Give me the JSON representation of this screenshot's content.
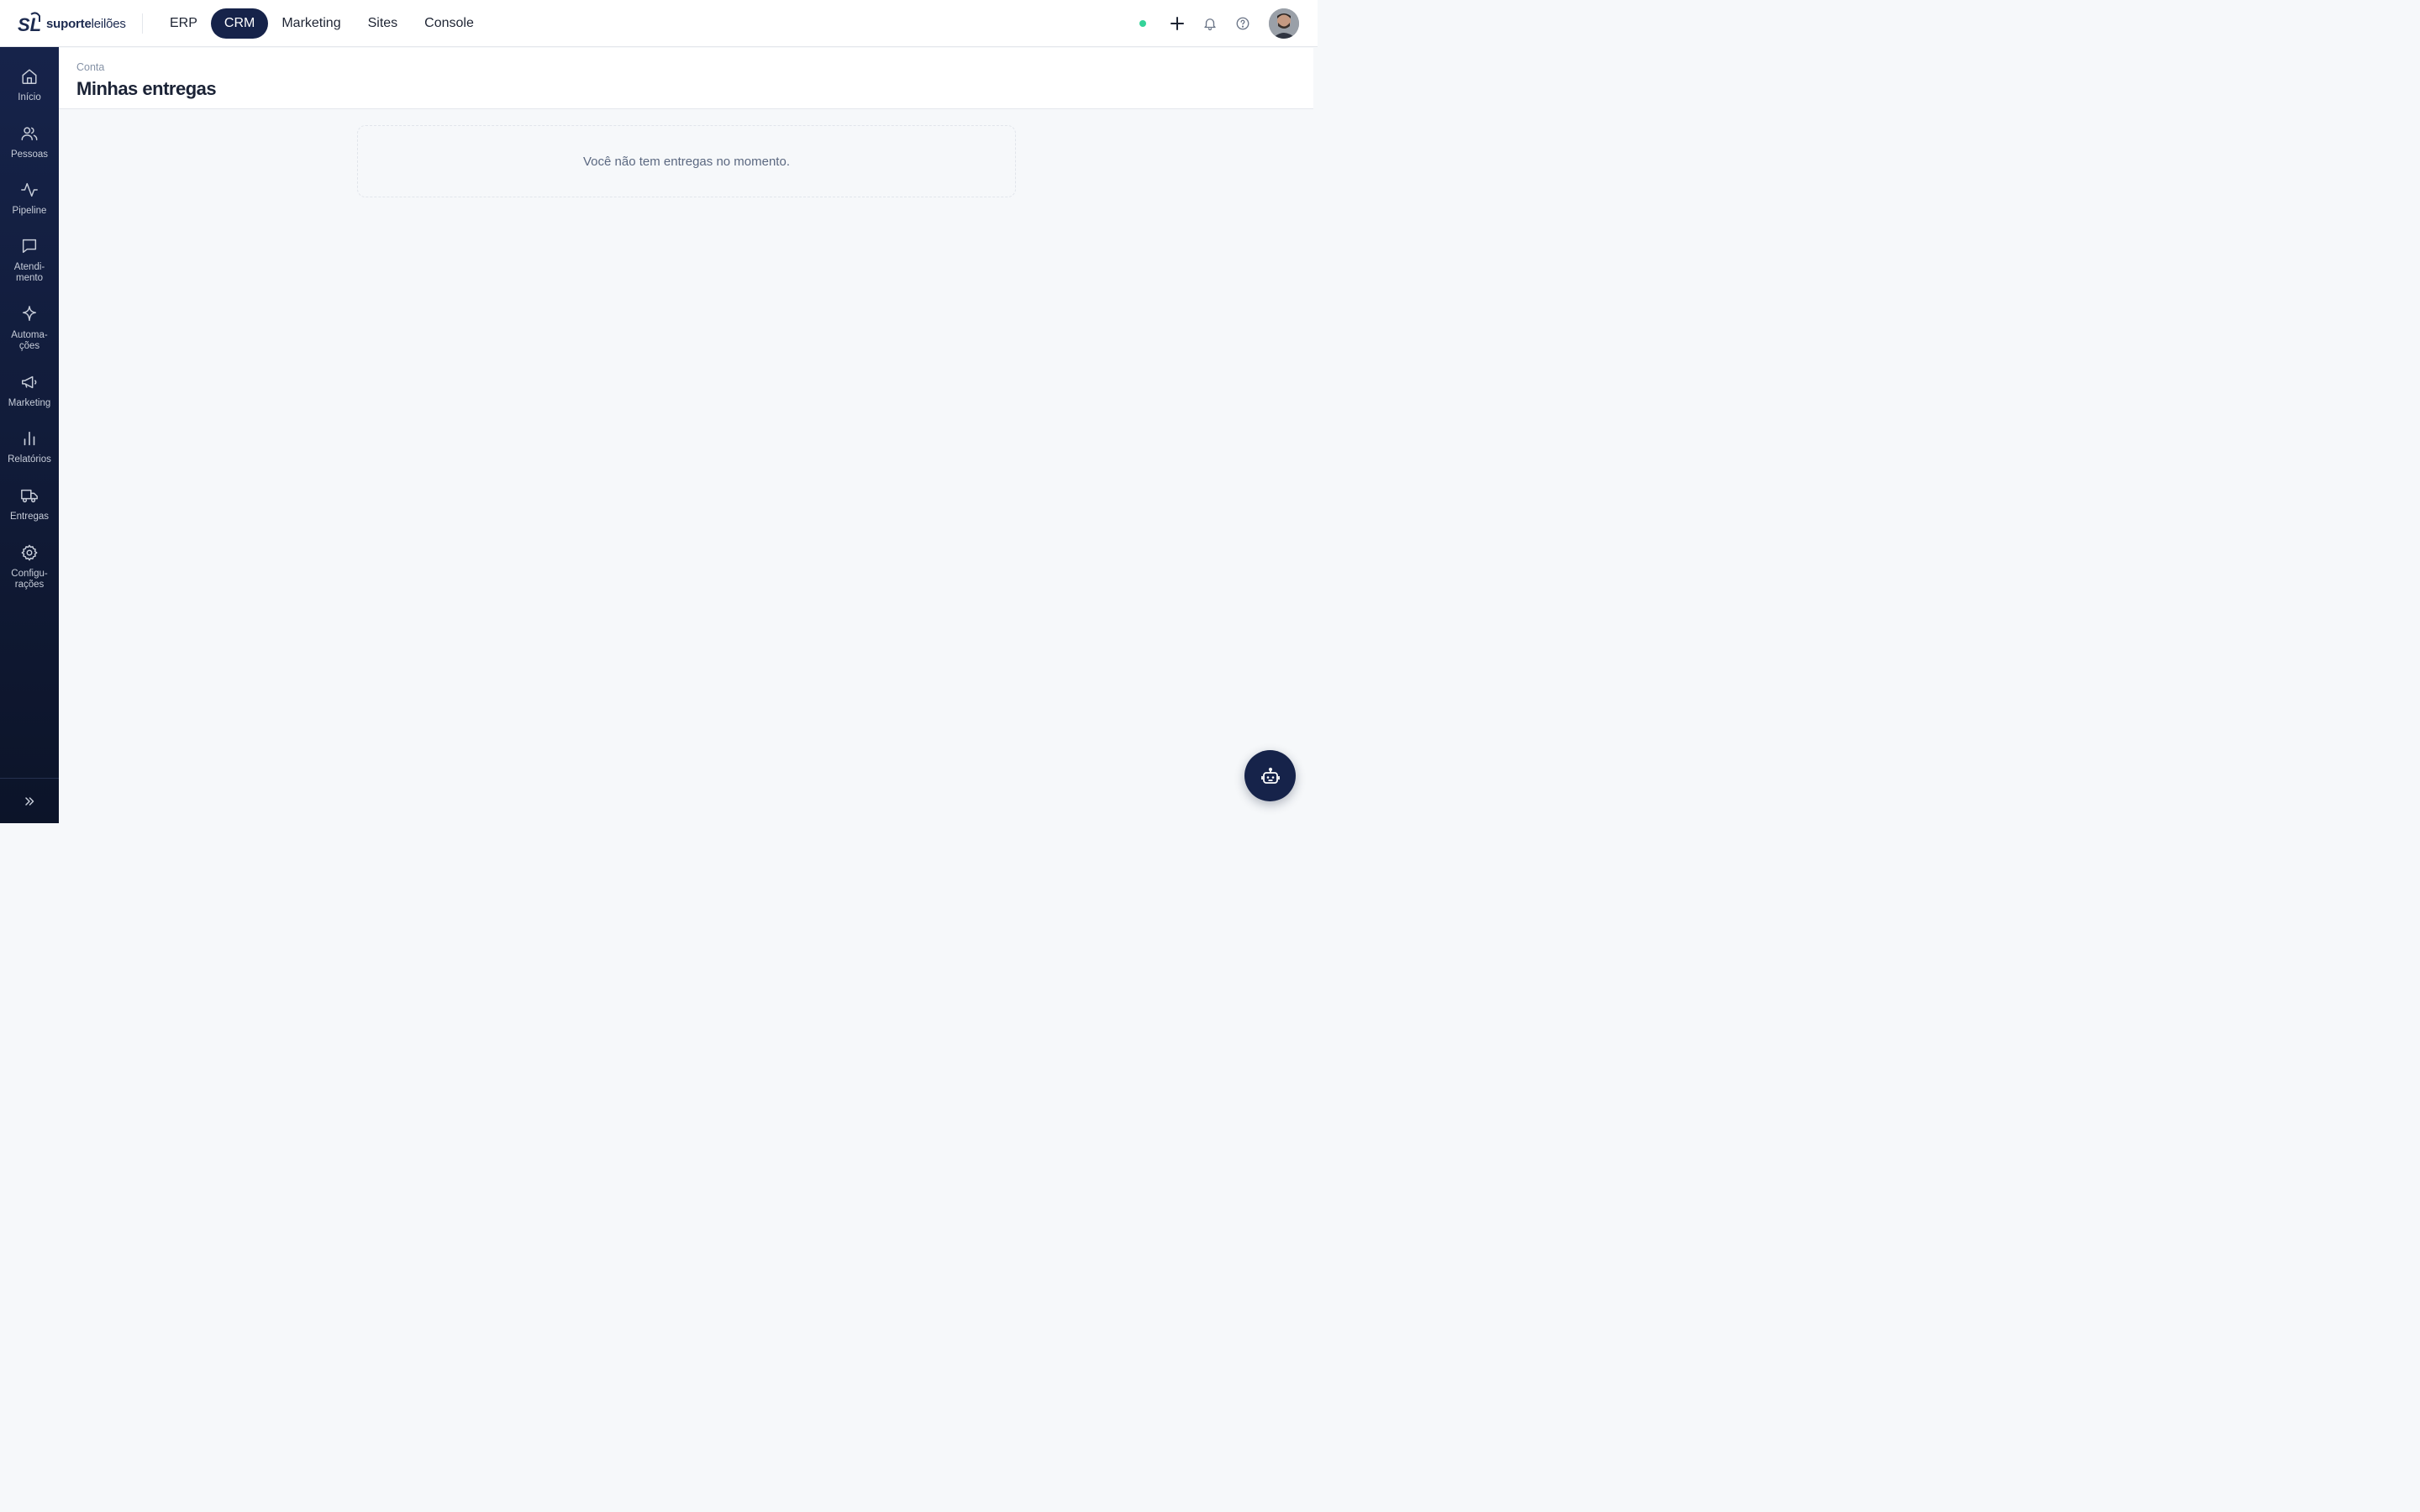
{
  "brand": {
    "name_bold": "suporte",
    "name_light": "leilões",
    "mark": "SL"
  },
  "topnav": [
    {
      "label": "ERP",
      "active": false
    },
    {
      "label": "CRM",
      "active": true
    },
    {
      "label": "Marketing",
      "active": false
    },
    {
      "label": "Sites",
      "active": false
    },
    {
      "label": "Console",
      "active": false
    }
  ],
  "topbar_icons": [
    "status-dot",
    "plus-icon",
    "bell-icon",
    "help-icon",
    "avatar"
  ],
  "sidebar": {
    "items": [
      {
        "label": "Início",
        "icon": "home-icon"
      },
      {
        "label": "Pessoas",
        "icon": "users-icon"
      },
      {
        "label": "Pipeline",
        "icon": "activity-icon"
      },
      {
        "label": "Atendi-\nmento",
        "icon": "message-icon"
      },
      {
        "label": "Automa-\nções",
        "icon": "sparkle-icon"
      },
      {
        "label": "Marketing",
        "icon": "megaphone-icon"
      },
      {
        "label": "Relatórios",
        "icon": "bar-chart-icon"
      },
      {
        "label": "Entregas",
        "icon": "truck-icon"
      },
      {
        "label": "Configu-\nrações",
        "icon": "gear-icon"
      }
    ],
    "expand_icon": "chevrons-right-icon"
  },
  "header": {
    "breadcrumb": "Conta",
    "title": "Minhas entregas"
  },
  "main": {
    "empty_message": "Você não tem entregas no momento."
  },
  "fab": {
    "icon": "bot-icon"
  },
  "colors": {
    "primary": "#16234a",
    "status": "#34d399",
    "background": "#f6f8fa"
  }
}
